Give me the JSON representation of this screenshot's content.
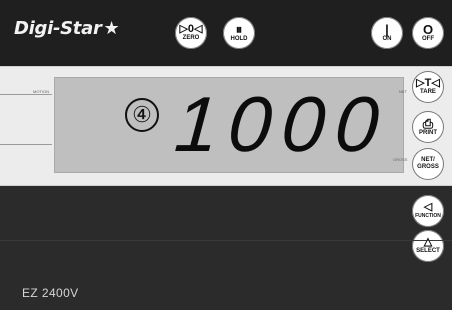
{
  "brand": {
    "logo_text": "Digi-Star",
    "logo_glyph": "★"
  },
  "topbar": {
    "buttons": [
      {
        "name": "zero",
        "icon": "zero-icon",
        "glyph": "▷0◁",
        "label": "ZERO"
      },
      {
        "name": "hold",
        "icon": "pause-icon",
        "glyph": "⏸",
        "label": "HOLD"
      },
      {
        "name": "on",
        "icon": "power-on-icon",
        "glyph": "|",
        "label": "ON"
      },
      {
        "name": "off",
        "icon": "power-off-icon",
        "glyph": "O",
        "label": "OFF"
      }
    ]
  },
  "display": {
    "indicator_value": "④",
    "reading": "1000",
    "labels": {
      "motion": "MOTION",
      "net": "NET",
      "gross": "GROSS"
    }
  },
  "side_buttons": [
    {
      "name": "tare",
      "icon": "tare-icon",
      "glyph": "▷T◁",
      "label": "TARE"
    },
    {
      "name": "print",
      "icon": "printer-icon",
      "glyph": "⎙",
      "label": "PRINT"
    },
    {
      "name": "net-gross",
      "icon": "net-gross-icon",
      "glyph": "NET/",
      "label": "GROSS"
    },
    {
      "name": "function",
      "icon": "left-triangle-icon",
      "glyph": "◁",
      "label": "FUNCTION"
    },
    {
      "name": "select",
      "icon": "up-triangle-icon",
      "glyph": "△",
      "label": "SELECT"
    }
  ],
  "model": "EZ 2400V",
  "colors": {
    "body": "#2b2b2b",
    "topbar": "#1f1f1f",
    "band": "#ececec",
    "lcd": "#bfbfbf",
    "button": "#ffffff"
  }
}
